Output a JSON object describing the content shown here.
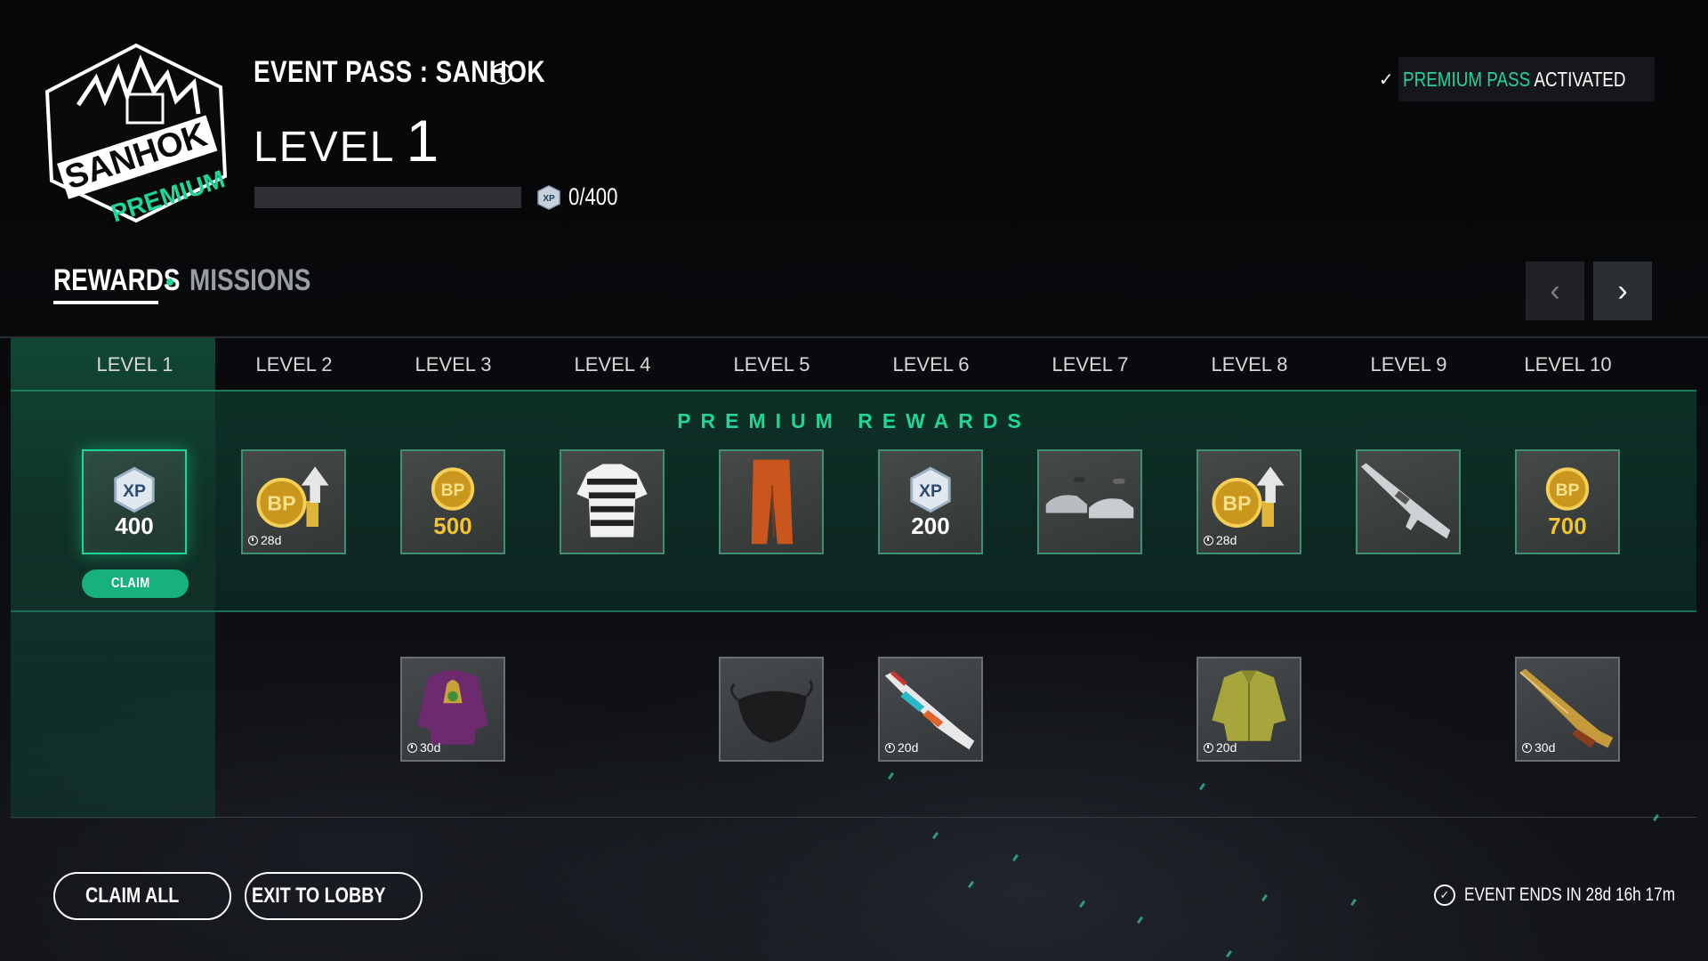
{
  "logo": {
    "line1": "SANHOK",
    "line2": "PREMIUM"
  },
  "header": {
    "event_title": "EVENT PASS : SANHOK",
    "level_label": "LEVEL",
    "level_number": "1",
    "xp_progress_text": "0/400",
    "xp_progress_fraction": 0,
    "help_icon": "question-circle-icon"
  },
  "premium_status": {
    "check_icon": "checkmark-icon",
    "highlight": "PREMIUM PASS",
    "rest": "ACTIVATED"
  },
  "tabs": {
    "rewards": "REWARDS",
    "missions": "MISSIONS",
    "active": "rewards"
  },
  "nav": {
    "prev_icon": "chevron-left-icon",
    "next_icon": "chevron-right-icon"
  },
  "levels": [
    "LEVEL 1",
    "LEVEL 2",
    "LEVEL 3",
    "LEVEL 4",
    "LEVEL 5",
    "LEVEL 6",
    "LEVEL 7",
    "LEVEL 8",
    "LEVEL 9",
    "LEVEL 10"
  ],
  "premium_label": "PREMIUM REWARDS",
  "premium_rewards": [
    {
      "level": 1,
      "type": "xp",
      "amount": "400",
      "claimable": true
    },
    {
      "level": 2,
      "type": "bp-boost",
      "duration": "28d"
    },
    {
      "level": 3,
      "type": "bp",
      "amount": "500"
    },
    {
      "level": 4,
      "type": "striped-shirt"
    },
    {
      "level": 5,
      "type": "orange-pants"
    },
    {
      "level": 6,
      "type": "xp",
      "amount": "200"
    },
    {
      "level": 7,
      "type": "grey-shoes"
    },
    {
      "level": 8,
      "type": "bp-boost",
      "duration": "28d"
    },
    {
      "level": 9,
      "type": "rifle"
    },
    {
      "level": 10,
      "type": "bp",
      "amount": "700"
    }
  ],
  "claim_label": "CLAIM",
  "free_rewards": [
    {
      "level": 3,
      "type": "purple-jacket",
      "duration": "30d"
    },
    {
      "level": 5,
      "type": "black-mask"
    },
    {
      "level": 6,
      "type": "painted-rifle",
      "duration": "20d"
    },
    {
      "level": 8,
      "type": "yellow-jacket",
      "duration": "20d"
    },
    {
      "level": 10,
      "type": "shotgun",
      "duration": "30d"
    }
  ],
  "footer": {
    "claim_all": "CLAIM ALL",
    "exit_to_lobby": "EXIT TO LOBBY",
    "event_ends": "EVENT ENDS IN 28d 16h 17m",
    "clock_icon": "clock-check-icon"
  },
  "colors": {
    "accent": "#1fd59a",
    "gold": "#f2c233",
    "claim": "#17b07f"
  }
}
